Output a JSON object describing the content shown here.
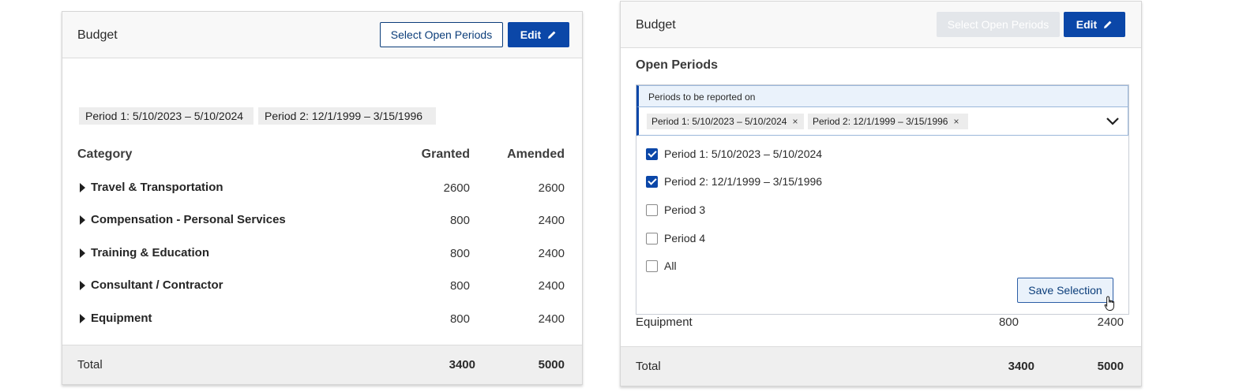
{
  "left_panel": {
    "title": "Budget",
    "select_button": "Select Open Periods",
    "edit_button": "Edit",
    "chips": [
      "Period 1: 5/10/2023 – 5/10/2024",
      "Period 2: 12/1/1999 – 3/15/1996"
    ],
    "columns": {
      "category": "Category",
      "granted": "Granted",
      "amended": "Amended"
    },
    "rows": [
      {
        "category": "Travel & Transportation",
        "granted": "2600",
        "amended": "2600"
      },
      {
        "category": "Compensation - Personal Services",
        "granted": "800",
        "amended": "2400"
      },
      {
        "category": "Training & Education",
        "granted": "800",
        "amended": "2400"
      },
      {
        "category": "Consultant / Contractor",
        "granted": "800",
        "amended": "2400"
      },
      {
        "category": "Equipment",
        "granted": "800",
        "amended": "2400"
      }
    ],
    "total": {
      "label": "Total",
      "granted": "3400",
      "amended": "5000"
    }
  },
  "right_panel": {
    "title": "Budget",
    "select_button": "Select Open Periods",
    "edit_button": "Edit",
    "heading": "Open Periods",
    "dropdown": {
      "label": "Periods to be reported on",
      "selected_tags": [
        "Period 1: 5/10/2023 – 5/10/2024",
        "Period 2: 12/1/1999 – 3/15/1996"
      ],
      "tag_remove": "×",
      "options": [
        {
          "label": "Period 1: 5/10/2023 – 5/10/2024",
          "checked": true
        },
        {
          "label": "Period 2: 12/1/1999 – 3/15/1996",
          "checked": true
        },
        {
          "label": "Period 3",
          "checked": false
        },
        {
          "label": "Period 4",
          "checked": false
        },
        {
          "label": "All",
          "checked": false
        }
      ],
      "save_button": "Save Selection"
    },
    "partial_row": {
      "category": "Equipment",
      "granted": "800",
      "amended": "2400"
    },
    "total": {
      "label": "Total",
      "granted": "3400",
      "amended": "5000"
    }
  },
  "colors": {
    "primary": "#0b47a8",
    "outline": "#0b3d7a",
    "disabled": "#e3e6ea",
    "total_bg": "#efefef",
    "chip_bg": "#ededed"
  },
  "icons": {
    "edit": "pencil-icon",
    "expand": "caret-right-icon",
    "dropdown": "chevron-down-icon",
    "remove": "close-icon",
    "cursor": "hand-pointer-icon"
  }
}
